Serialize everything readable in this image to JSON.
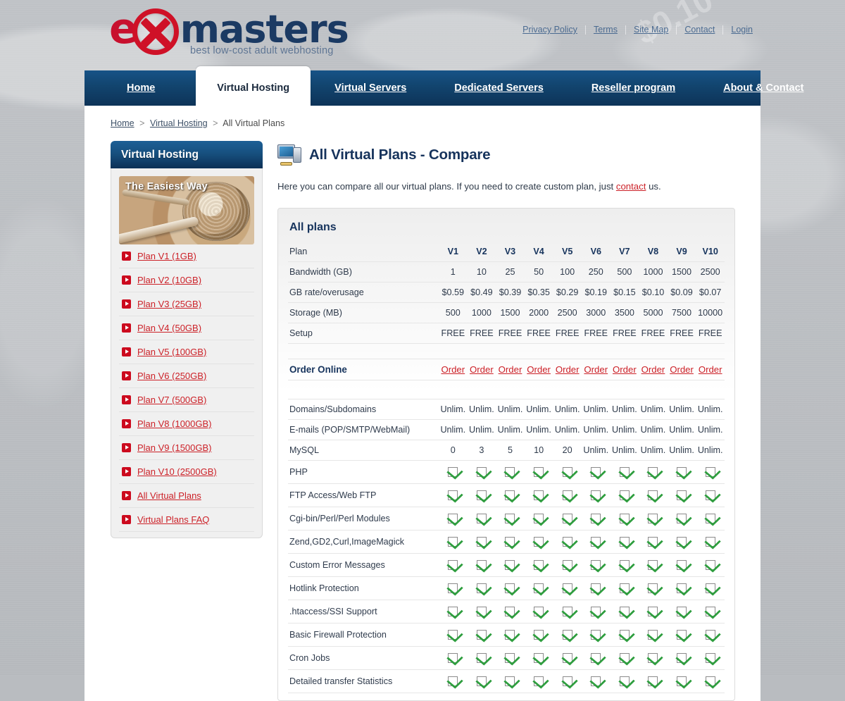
{
  "brand": {
    "logo_letter": "e",
    "logo_word": "masters",
    "tagline": "best low-cost adult webhosting",
    "x_icon": "circle-x-icon"
  },
  "top_links": [
    {
      "label": "Privacy Policy"
    },
    {
      "label": "Terms"
    },
    {
      "label": "Site Map"
    },
    {
      "label": "Contact"
    },
    {
      "label": "Login"
    }
  ],
  "nav": [
    {
      "label": "Home",
      "active": false
    },
    {
      "label": "Virtual Hosting",
      "active": true
    },
    {
      "label": "Virtual Servers",
      "active": false
    },
    {
      "label": "Dedicated Servers",
      "active": false
    },
    {
      "label": "Reseller program",
      "active": false
    },
    {
      "label": "About & Contact",
      "active": false
    }
  ],
  "breadcrumb": {
    "home": "Home",
    "section": "Virtual Hosting",
    "current": "All Virtual Plans",
    "separator": ">"
  },
  "sidebar": {
    "heading": "Virtual Hosting",
    "banner_caption": "The Easiest Way",
    "items": [
      {
        "label": "Plan V1 (1GB)"
      },
      {
        "label": "Plan V2 (10GB)"
      },
      {
        "label": "Plan V3 (25GB)"
      },
      {
        "label": "Plan V4 (50GB)"
      },
      {
        "label": "Plan V5 (100GB)"
      },
      {
        "label": "Plan V6 (250GB)"
      },
      {
        "label": "Plan V7 (500GB)"
      },
      {
        "label": "Plan V8 (1000GB)"
      },
      {
        "label": "Plan V9 (1500GB)"
      },
      {
        "label": "Plan V10 (2500GB)"
      },
      {
        "label": "All Virtual Plans"
      },
      {
        "label": "Virtual Plans FAQ"
      }
    ]
  },
  "main": {
    "title": "All Virtual Plans - Compare",
    "title_icon": "computer-monitor-icon",
    "intro_before": "Here you can compare all our virtual plans. If you need to create custom plan, just ",
    "intro_link": "contact",
    "intro_after": " us.",
    "panel_title": "All plans"
  },
  "chart_data": {
    "type": "table",
    "title": "All plans",
    "columns": [
      "Plan",
      "V1",
      "V2",
      "V3",
      "V4",
      "V5",
      "V6",
      "V7",
      "V8",
      "V9",
      "V10"
    ],
    "spec_rows": [
      {
        "label": "Bandwidth (GB)",
        "values": [
          "1",
          "10",
          "25",
          "50",
          "100",
          "250",
          "500",
          "1000",
          "1500",
          "2500"
        ]
      },
      {
        "label": "GB rate/overusage",
        "values": [
          "$0.59",
          "$0.49",
          "$0.39",
          "$0.35",
          "$0.29",
          "$0.19",
          "$0.15",
          "$0.10",
          "$0.09",
          "$0.07"
        ]
      },
      {
        "label": "Storage (MB)",
        "values": [
          "500",
          "1000",
          "1500",
          "2000",
          "2500",
          "3000",
          "3500",
          "5000",
          "7500",
          "10000"
        ]
      },
      {
        "label": "Setup",
        "values": [
          "FREE",
          "FREE",
          "FREE",
          "FREE",
          "FREE",
          "FREE",
          "FREE",
          "FREE",
          "FREE",
          "FREE"
        ]
      }
    ],
    "order_row": {
      "label": "Order Online",
      "values": [
        "Order",
        "Order",
        "Order",
        "Order",
        "Order",
        "Order",
        "Order",
        "Order",
        "Order",
        "Order"
      ]
    },
    "text_rows": [
      {
        "label": "Domains/Subdomains",
        "values": [
          "Unlim.",
          "Unlim.",
          "Unlim.",
          "Unlim.",
          "Unlim.",
          "Unlim.",
          "Unlim.",
          "Unlim.",
          "Unlim.",
          "Unlim."
        ]
      },
      {
        "label": "E-mails (POP/SMTP/WebMail)",
        "values": [
          "Unlim.",
          "Unlim.",
          "Unlim.",
          "Unlim.",
          "Unlim.",
          "Unlim.",
          "Unlim.",
          "Unlim.",
          "Unlim.",
          "Unlim."
        ]
      },
      {
        "label": "MySQL",
        "values": [
          "0",
          "3",
          "5",
          "10",
          "20",
          "Unlim.",
          "Unlim.",
          "Unlim.",
          "Unlim.",
          "Unlim."
        ]
      }
    ],
    "check_rows": [
      {
        "label": "PHP",
        "values": [
          true,
          true,
          true,
          true,
          true,
          true,
          true,
          true,
          true,
          true
        ]
      },
      {
        "label": "FTP Access/Web FTP",
        "values": [
          true,
          true,
          true,
          true,
          true,
          true,
          true,
          true,
          true,
          true
        ]
      },
      {
        "label": "Cgi-bin/Perl/Perl Modules",
        "values": [
          true,
          true,
          true,
          true,
          true,
          true,
          true,
          true,
          true,
          true
        ]
      },
      {
        "label": "Zend,GD2,Curl,ImageMagick",
        "values": [
          true,
          true,
          true,
          true,
          true,
          true,
          true,
          true,
          true,
          true
        ]
      },
      {
        "label": "Custom Error Messages",
        "values": [
          true,
          true,
          true,
          true,
          true,
          true,
          true,
          true,
          true,
          true
        ]
      },
      {
        "label": "Hotlink Protection",
        "values": [
          true,
          true,
          true,
          true,
          true,
          true,
          true,
          true,
          true,
          true
        ]
      },
      {
        "label": ".htaccess/SSI Support",
        "values": [
          true,
          true,
          true,
          true,
          true,
          true,
          true,
          true,
          true,
          true
        ]
      },
      {
        "label": "Basic Firewall Protection",
        "values": [
          true,
          true,
          true,
          true,
          true,
          true,
          true,
          true,
          true,
          true
        ]
      },
      {
        "label": "Cron Jobs",
        "values": [
          true,
          true,
          true,
          true,
          true,
          true,
          true,
          true,
          true,
          true
        ]
      },
      {
        "label": "Detailed transfer Statistics",
        "values": [
          true,
          true,
          true,
          true,
          true,
          true,
          true,
          true,
          true,
          true
        ]
      }
    ]
  },
  "colors": {
    "nav_blue": "#12456f",
    "brand_red": "#cc2128",
    "title_navy": "#16335c",
    "check_green": "#2f9e3f",
    "page_gray": "#b9bcc0"
  }
}
